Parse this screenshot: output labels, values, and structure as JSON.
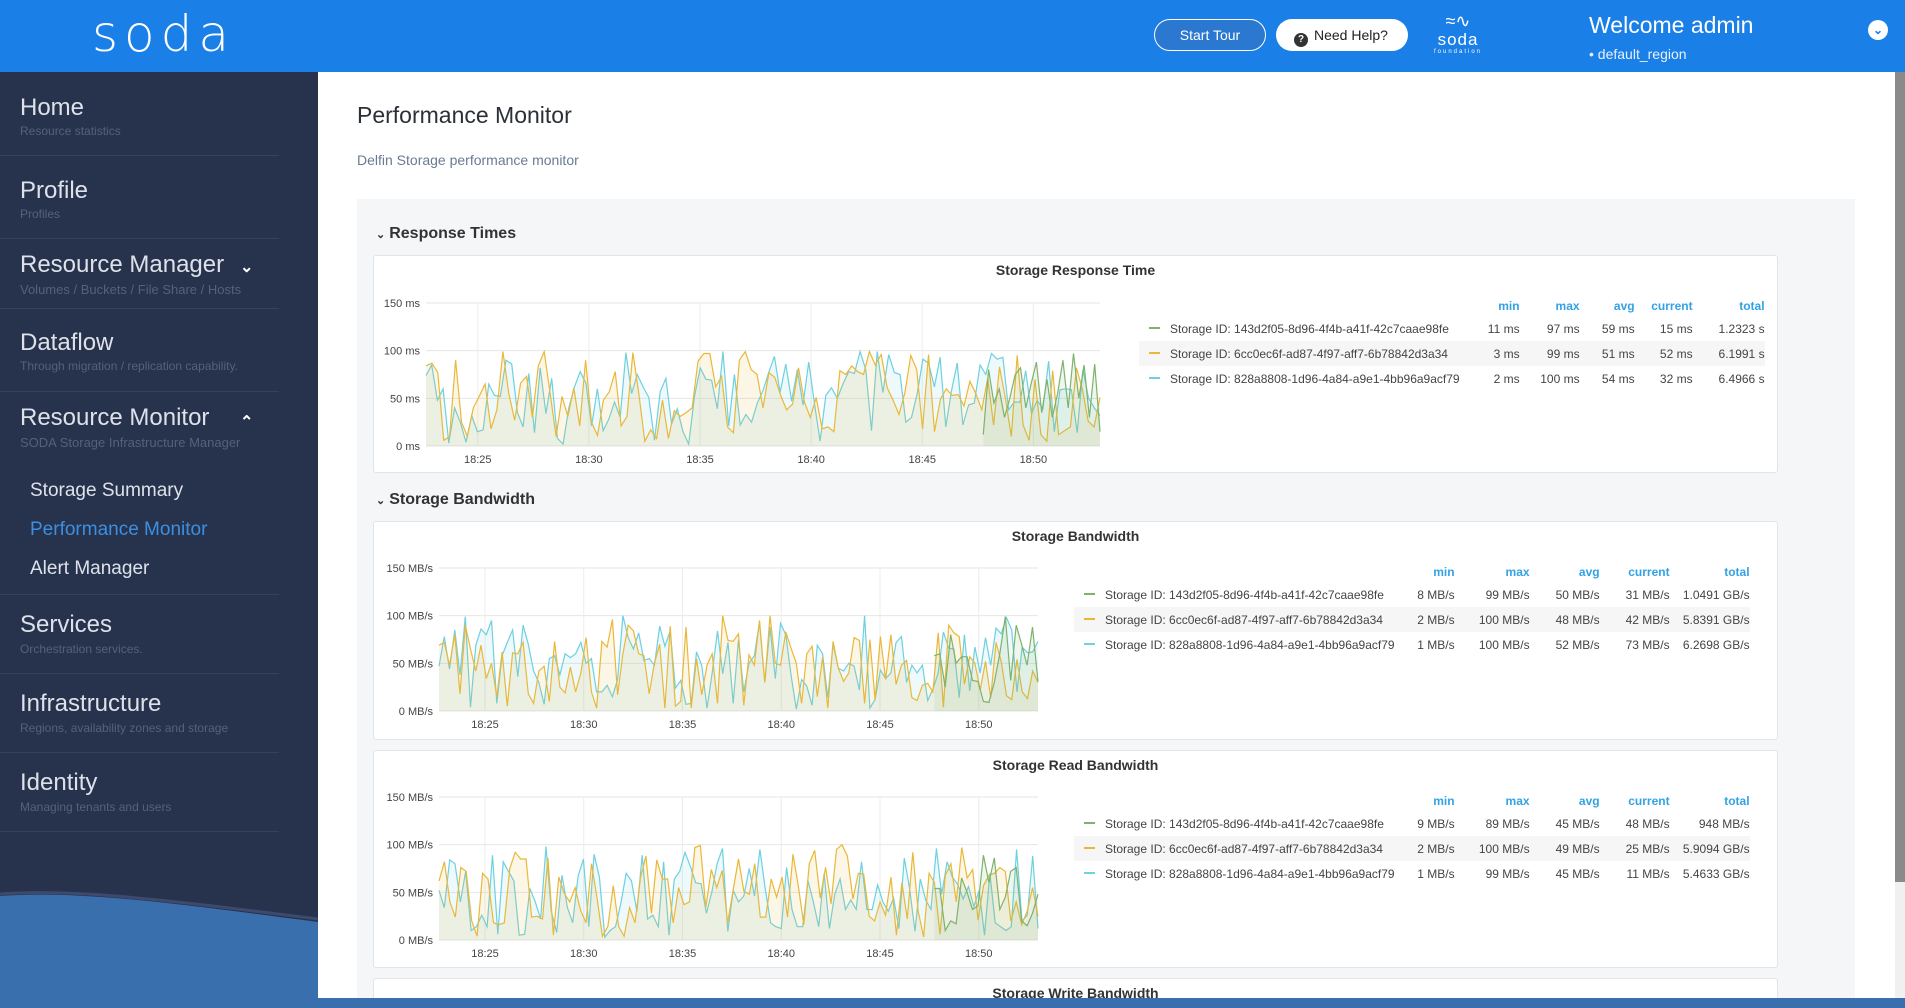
{
  "header": {
    "logo": "soda",
    "start_tour": "Start Tour",
    "need_help": "Need Help?",
    "foundation_logo_top": "soda",
    "foundation_logo_bottom": "foundation",
    "welcome": "Welcome admin",
    "region": "default_region"
  },
  "sidebar": {
    "items": [
      {
        "title": "Home",
        "sub": "Resource statistics"
      },
      {
        "title": "Profile",
        "sub": "Profiles"
      },
      {
        "title": "Resource Manager",
        "sub": "Volumes / Buckets / File Share / Hosts",
        "expanded": false
      },
      {
        "title": "Dataflow",
        "sub": "Through migration / replication capability."
      },
      {
        "title": "Resource Monitor",
        "sub": "SODA Storage Infrastructure Manager",
        "expanded": true
      },
      {
        "title": "Services",
        "sub": "Orchestration services."
      },
      {
        "title": "Infrastructure",
        "sub": "Regions, availability zones and storage"
      },
      {
        "title": "Identity",
        "sub": "Managing tenants and users"
      }
    ],
    "sub_items": [
      {
        "label": "Storage Summary",
        "active": false
      },
      {
        "label": "Performance Monitor",
        "active": true
      },
      {
        "label": "Alert Manager",
        "active": false
      }
    ]
  },
  "page": {
    "title": "Performance Monitor",
    "subtitle": "Delfin Storage performance monitor"
  },
  "sections": [
    {
      "label": "Response Times"
    },
    {
      "label": "Storage Bandwidth"
    }
  ],
  "colors": {
    "green": "#7eb26d",
    "orange": "#eab839",
    "cyan": "#6ed0e0",
    "header_blue": "#1b7fe8",
    "sidebar_navy": "#27324d",
    "active_link": "#3d8fe0"
  },
  "legend_headers": [
    "min",
    "max",
    "avg",
    "current",
    "total"
  ],
  "chart_data": [
    {
      "type": "line",
      "title": "Storage Response Time",
      "ylim": [
        0,
        150
      ],
      "yticks": [
        "0 ms",
        "50 ms",
        "100 ms",
        "150 ms"
      ],
      "ytick_values": [
        0,
        50,
        100,
        150
      ],
      "xlim": [
        "18:22:40",
        "18:53:00"
      ],
      "xticks": [
        "18:25",
        "18:30",
        "18:35",
        "18:40",
        "18:45",
        "18:50"
      ],
      "xtick_minutes": [
        25,
        30,
        35,
        40,
        45,
        50
      ],
      "x_start_minute": 22.67,
      "x_end_minute": 53.0,
      "grid": true,
      "legend_placement": "right",
      "series": [
        {
          "name": "Storage ID: 143d2f05-8d96-4f4b-a41f-42c7caae98fe",
          "color": "#7eb26d",
          "start_minute": 47.75,
          "values": [
            12,
            80,
            45,
            60,
            30,
            50,
            75,
            82,
            40,
            65,
            88,
            35,
            70,
            30,
            55,
            90,
            40,
            97,
            50,
            85,
            30,
            86,
            15
          ],
          "stats": {
            "min": "11 ms",
            "max": "97 ms",
            "avg": "59 ms",
            "current": "15 ms",
            "total": "1.2323 s"
          }
        },
        {
          "name": "Storage ID: 6cc0ec6f-ad87-4f97-aff7-6b78842d3a34",
          "color": "#eab839",
          "start_minute": 22.67,
          "values": [
            84,
            87,
            77,
            6,
            10,
            90,
            25,
            10,
            40,
            52,
            65,
            18,
            38,
            99,
            55,
            27,
            66,
            73,
            30,
            84,
            99,
            55,
            10,
            52,
            31,
            61,
            21,
            90,
            25,
            11,
            48,
            57,
            78,
            21,
            31,
            98,
            55,
            5,
            17,
            8,
            48,
            8,
            37,
            31,
            35,
            40,
            89,
            97,
            97,
            62,
            73,
            20,
            14,
            90,
            99,
            80,
            75,
            40,
            77,
            72,
            53,
            38,
            44,
            82,
            46,
            30,
            51,
            18,
            20,
            15,
            79,
            75,
            84,
            78,
            75,
            99,
            85,
            96,
            61,
            48,
            33,
            56,
            95,
            80,
            18,
            96,
            15,
            49,
            60,
            53,
            54,
            42,
            68,
            55,
            38,
            71,
            22,
            83,
            50,
            10,
            95,
            22,
            6,
            70,
            12,
            5,
            79,
            12,
            16,
            20,
            82,
            60,
            26,
            20,
            51
          ],
          "stats": {
            "min": "3 ms",
            "max": "99 ms",
            "avg": "51 ms",
            "current": "52 ms",
            "total": "6.1991 s"
          }
        },
        {
          "name": "Storage ID: 828a8808-1d96-4a84-a9e1-4bb96a9acf79",
          "color": "#6ed0e0",
          "start_minute": 22.67,
          "values": [
            74,
            85,
            48,
            60,
            3,
            40,
            25,
            4,
            32,
            15,
            17,
            65,
            53,
            52,
            90,
            86,
            35,
            20,
            76,
            14,
            82,
            34,
            71,
            8,
            2,
            40,
            62,
            78,
            66,
            21,
            60,
            16,
            28,
            46,
            30,
            98,
            55,
            75,
            62,
            51,
            6,
            57,
            71,
            23,
            39,
            15,
            2,
            52,
            82,
            70,
            69,
            39,
            99,
            21,
            75,
            22,
            33,
            25,
            45,
            58,
            77,
            94,
            56,
            86,
            47,
            80,
            43,
            88,
            45,
            5,
            53,
            61,
            50,
            65,
            78,
            76,
            99,
            80,
            16,
            99,
            56,
            96,
            77,
            75,
            25,
            30,
            55,
            91,
            87,
            62,
            93,
            20,
            58,
            87,
            22,
            43,
            45,
            85,
            75,
            97,
            91,
            93,
            38,
            46,
            46,
            79,
            34,
            48,
            39,
            89,
            15,
            59,
            60,
            59,
            14,
            80,
            50,
            40,
            32
          ],
          "stats": {
            "min": "2 ms",
            "max": "100 ms",
            "avg": "54 ms",
            "current": "32 ms",
            "total": "6.4966 s"
          }
        }
      ]
    },
    {
      "type": "line",
      "title": "Storage Bandwidth",
      "ylim": [
        0,
        150
      ],
      "yticks": [
        "0 MB/s",
        "50 MB/s",
        "100 MB/s",
        "150 MB/s"
      ],
      "ytick_values": [
        0,
        50,
        100,
        150
      ],
      "xlim": [
        "18:22:40",
        "18:53:00"
      ],
      "xticks": [
        "18:25",
        "18:30",
        "18:35",
        "18:40",
        "18:45",
        "18:50"
      ],
      "xtick_minutes": [
        25,
        30,
        35,
        40,
        45,
        50
      ],
      "x_start_minute": 22.67,
      "x_end_minute": 53.0,
      "grid": true,
      "legend_placement": "right",
      "series": [
        {
          "name": "Storage ID: 143d2f05-8d96-4f4b-a41f-42c7caae98fe",
          "color": "#7eb26d",
          "start_minute": 47.75,
          "values": [
            58,
            60,
            25,
            80,
            50,
            57,
            57,
            32,
            31,
            10,
            9,
            30,
            60,
            99,
            32,
            90,
            70,
            48,
            88,
            31
          ],
          "stats": {
            "min": "8 MB/s",
            "max": "99 MB/s",
            "avg": "50 MB/s",
            "current": "31 MB/s",
            "total": "1.0491 GB/s"
          }
        },
        {
          "name": "Storage ID: 6cc0ec6f-ad87-4f97-aff7-6b78842d3a34",
          "color": "#eab839",
          "start_minute": 22.67,
          "values": [
            69,
            72,
            48,
            80,
            18,
            90,
            65,
            42,
            69,
            34,
            50,
            15,
            62,
            5,
            61,
            60,
            72,
            18,
            8,
            42,
            47,
            10,
            73,
            25,
            19,
            46,
            20,
            40,
            77,
            20,
            3,
            73,
            67,
            96,
            17,
            60,
            90,
            84,
            60,
            58,
            18,
            50,
            70,
            3,
            89,
            5,
            10,
            88,
            3,
            55,
            17,
            48,
            60,
            8,
            100,
            74,
            73,
            81,
            6,
            59,
            48,
            95,
            30,
            100,
            50,
            48,
            83,
            66,
            50,
            8,
            60,
            68,
            15,
            56,
            3,
            73,
            45,
            31,
            40,
            77,
            74,
            8,
            75,
            12,
            78,
            33,
            80,
            28,
            48,
            53,
            14,
            11,
            27,
            29,
            20,
            82,
            4,
            90,
            82,
            78,
            28,
            57,
            50,
            22,
            52,
            14,
            72,
            52,
            16,
            12,
            54,
            20,
            13,
            42,
            30
          ],
          "stats": {
            "min": "2 MB/s",
            "max": "100 MB/s",
            "avg": "48 MB/s",
            "current": "42 MB/s",
            "total": "5.8391 GB/s"
          }
        },
        {
          "name": "Storage ID: 828a8808-1d96-4a84-a9e1-4bb96a9acf79",
          "color": "#6ed0e0",
          "start_minute": 22.67,
          "values": [
            47,
            78,
            44,
            85,
            38,
            99,
            4,
            69,
            86,
            80,
            95,
            8,
            58,
            72,
            85,
            36,
            90,
            70,
            42,
            30,
            7,
            55,
            58,
            38,
            60,
            56,
            60,
            72,
            50,
            55,
            20,
            20,
            27,
            15,
            33,
            100,
            77,
            65,
            82,
            53,
            55,
            48,
            89,
            68,
            84,
            24,
            32,
            7,
            8,
            62,
            48,
            3,
            40,
            84,
            39,
            72,
            8,
            75,
            20,
            50,
            58,
            93,
            30,
            88,
            34,
            92,
            80,
            38,
            2,
            33,
            26,
            6,
            69,
            60,
            14,
            70,
            45,
            42,
            50,
            47,
            22,
            100,
            3,
            12,
            43,
            34,
            40,
            72,
            78,
            30,
            48,
            40,
            48,
            11,
            23,
            40,
            83,
            66,
            65,
            14,
            80,
            21,
            67,
            40,
            77,
            48,
            87,
            81,
            98,
            85,
            20,
            67,
            61,
            62,
            73
          ],
          "stats": {
            "min": "1 MB/s",
            "max": "100 MB/s",
            "avg": "52 MB/s",
            "current": "73 MB/s",
            "total": "6.2698 GB/s"
          }
        }
      ]
    },
    {
      "type": "line",
      "title": "Storage Read Bandwidth",
      "ylim": [
        0,
        150
      ],
      "yticks": [
        "0 MB/s",
        "50 MB/s",
        "100 MB/s",
        "150 MB/s"
      ],
      "ytick_values": [
        0,
        50,
        100,
        150
      ],
      "xlim": [
        "18:22:40",
        "18:53:00"
      ],
      "xticks": [
        "18:25",
        "18:30",
        "18:35",
        "18:40",
        "18:45",
        "18:50"
      ],
      "xtick_minutes": [
        25,
        30,
        35,
        40,
        45,
        50
      ],
      "x_start_minute": 22.67,
      "x_end_minute": 53.0,
      "grid": true,
      "legend_placement": "right",
      "series": [
        {
          "name": "Storage ID: 143d2f05-8d96-4f4b-a41f-42c7caae98fe",
          "color": "#7eb26d",
          "start_minute": 47.75,
          "values": [
            54,
            54,
            10,
            20,
            17,
            65,
            50,
            32,
            36,
            89,
            60,
            86,
            32,
            45,
            72,
            76,
            20,
            15,
            28,
            48
          ],
          "stats": {
            "min": "9 MB/s",
            "max": "89 MB/s",
            "avg": "45 MB/s",
            "current": "48 MB/s",
            "total": "948 MB/s"
          }
        },
        {
          "name": "Storage ID: 6cc0ec6f-ad87-4f97-aff7-6b78842d3a34",
          "color": "#eab839",
          "start_minute": 22.67,
          "values": [
            62,
            82,
            40,
            24,
            76,
            72,
            20,
            4,
            70,
            64,
            18,
            16,
            18,
            75,
            92,
            85,
            85,
            24,
            25,
            22,
            86,
            5,
            66,
            49,
            40,
            55,
            31,
            18,
            80,
            45,
            4,
            14,
            57,
            14,
            4,
            34,
            18,
            65,
            88,
            28,
            84,
            64,
            64,
            18,
            55,
            37,
            40,
            97,
            99,
            34,
            74,
            55,
            73,
            18,
            52,
            85,
            51,
            48,
            80,
            24,
            24,
            64,
            45,
            66,
            24,
            90,
            56,
            16,
            80,
            94,
            44,
            76,
            38,
            95,
            100,
            88,
            43,
            70,
            69,
            25,
            20,
            40,
            26,
            66,
            5,
            60,
            22,
            92,
            30,
            3,
            70,
            60,
            6,
            68,
            80,
            40,
            97,
            65,
            74,
            21,
            57,
            68,
            70,
            76,
            72,
            20,
            40,
            16,
            30,
            55,
            25
          ],
          "stats": {
            "min": "2 MB/s",
            "max": "100 MB/s",
            "avg": "49 MB/s",
            "current": "25 MB/s",
            "total": "5.9094 GB/s"
          }
        },
        {
          "name": "Storage ID: 828a8808-1d96-4a84-a9e1-4bb96a9acf79",
          "color": "#6ed0e0",
          "start_minute": 22.67,
          "values": [
            52,
            34,
            84,
            80,
            40,
            72,
            10,
            14,
            26,
            14,
            89,
            6,
            82,
            72,
            62,
            5,
            6,
            54,
            40,
            22,
            98,
            30,
            8,
            68,
            34,
            18,
            67,
            85,
            14,
            90,
            66,
            3,
            10,
            14,
            38,
            70,
            62,
            30,
            89,
            22,
            26,
            14,
            82,
            5,
            64,
            72,
            92,
            77,
            60,
            59,
            28,
            50,
            80,
            96,
            9,
            52,
            40,
            46,
            75,
            46,
            95,
            54,
            18,
            14,
            12,
            76,
            32,
            14,
            14,
            62,
            40,
            14,
            70,
            12,
            48,
            64,
            32,
            42,
            32,
            82,
            32,
            32,
            58,
            40,
            30,
            44,
            12,
            86,
            54,
            9,
            64,
            42,
            32,
            96,
            48,
            82,
            66,
            58,
            43,
            56,
            35,
            52,
            5,
            70,
            18,
            14,
            10,
            14,
            95,
            20,
            26,
            88,
            12
          ],
          "stats": {
            "min": "1 MB/s",
            "max": "99 MB/s",
            "avg": "45 MB/s",
            "current": "11 MB/s",
            "total": "5.4633 GB/s"
          }
        }
      ]
    },
    {
      "type": "line",
      "title": "Storage Write Bandwidth",
      "series": []
    }
  ]
}
